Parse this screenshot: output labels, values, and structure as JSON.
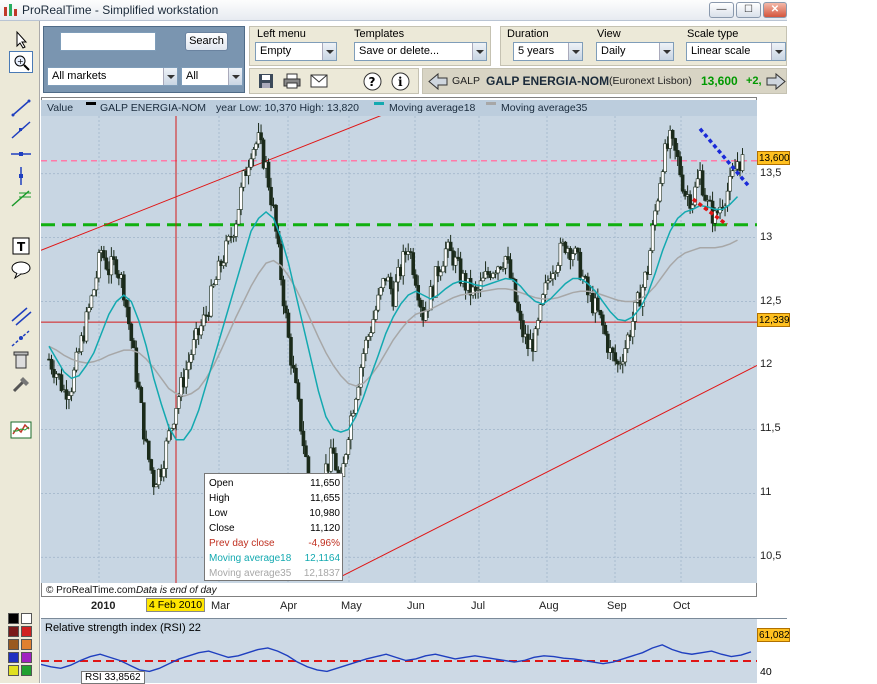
{
  "window": {
    "title": "ProRealTime - Simplified workstation",
    "buttons": [
      "—",
      "☐",
      "✕"
    ]
  },
  "search": {
    "value": "",
    "button": "Search",
    "market": "All markets",
    "filter": "All"
  },
  "settings": {
    "left_menu_label": "Left menu",
    "left_menu_value": "Empty",
    "templates_label": "Templates",
    "templates_value": "Save or delete...",
    "duration_label": "Duration",
    "duration_value": "5 years",
    "view_label": "View",
    "view_value": "Daily",
    "scale_label": "Scale type",
    "scale_value": "Linear scale"
  },
  "instrument": {
    "code": "GALP",
    "name": "GALP ENERGIA-NOM",
    "exchange": "(Euronext Lisbon)",
    "price": "13,600",
    "change": "+2,",
    "up_color": "#009900"
  },
  "legend": {
    "value": "Value",
    "series": "GALP ENERGIA-NOM",
    "year_range": "year Low: 10,370 High: 13,820",
    "ma18": "Moving average18",
    "ma35": "Moving average35",
    "ma18_color": "#13a9b0",
    "ma35_color": "#a7a7a7"
  },
  "chart_data": {
    "type": "candlestick",
    "price_ticks": [
      "13,5",
      "13",
      "12,5",
      "12",
      "11,5",
      "11",
      "10,5"
    ],
    "month_labels": [
      "2010",
      "Mar",
      "Apr",
      "May",
      "Jun",
      "Jul",
      "Aug",
      "Sep",
      "Oct"
    ],
    "cursor_date": "4 Feb 2010",
    "price_markers": {
      "last": "13,600",
      "line": "12,339"
    },
    "support_level": 13.1,
    "resistance_level": 13.6,
    "red_horizontal": 12.339,
    "ylim": [
      10.3,
      13.95
    ],
    "close_series": [
      12.05,
      11.95,
      11.8,
      11.85,
      12.1,
      12.35,
      12.6,
      12.9,
      12.75,
      12.8,
      12.6,
      12.2,
      11.8,
      11.35,
      11.1,
      11.2,
      11.45,
      11.7,
      11.9,
      12.1,
      12.25,
      12.4,
      12.6,
      12.8,
      12.95,
      13.15,
      13.45,
      13.7,
      13.75,
      13.55,
      13.2,
      12.7,
      12.2,
      11.8,
      11.4,
      11.0,
      10.8,
      11.2,
      11.3,
      11.05,
      11.5,
      11.8,
      12.1,
      12.3,
      12.5,
      12.7,
      12.55,
      12.75,
      12.95,
      12.7,
      12.4,
      12.55,
      12.75,
      12.9,
      12.85,
      12.7,
      12.6,
      12.55,
      12.65,
      12.75,
      12.8,
      12.85,
      12.6,
      12.3,
      12.15,
      12.2,
      12.5,
      12.75,
      12.85,
      12.95,
      12.9,
      12.75,
      12.55,
      12.45,
      12.3,
      12.1,
      12.0,
      12.15,
      12.35,
      12.55,
      12.75,
      13.2,
      13.6,
      13.75,
      13.6,
      13.35,
      13.3,
      13.5,
      13.25,
      13.15,
      13.3,
      13.4,
      13.6
    ],
    "ma18": [
      12.15,
      12.05,
      11.95,
      11.9,
      11.92,
      12.0,
      12.1,
      12.25,
      12.4,
      12.5,
      12.55,
      12.5,
      12.35,
      12.15,
      11.9,
      11.7,
      11.52,
      11.42,
      11.42,
      11.5,
      11.65,
      11.85,
      12.05,
      12.25,
      12.45,
      12.65,
      12.85,
      13.05,
      13.15,
      13.2,
      13.15,
      13.0,
      12.8,
      12.55,
      12.3,
      12.05,
      11.8,
      11.6,
      11.5,
      11.48,
      11.5,
      11.6,
      11.75,
      11.92,
      12.08,
      12.25,
      12.38,
      12.48,
      12.55,
      12.58,
      12.55,
      12.52,
      12.55,
      12.6,
      12.64,
      12.66,
      12.65,
      12.63,
      12.62,
      12.64,
      12.66,
      12.68,
      12.67,
      12.62,
      12.55,
      12.5,
      12.48,
      12.52,
      12.58,
      12.64,
      12.68,
      12.68,
      12.64,
      12.58,
      12.5,
      12.42,
      12.36,
      12.35,
      12.38,
      12.45,
      12.56,
      12.72,
      12.9,
      13.05,
      13.15,
      13.2,
      13.22,
      13.25,
      13.24,
      13.22,
      13.22,
      13.26,
      13.32
    ],
    "ma35": [
      12.15,
      12.12,
      12.08,
      12.05,
      12.03,
      12.02,
      12.03,
      12.05,
      12.08,
      12.1,
      12.12,
      12.12,
      12.1,
      12.05,
      11.98,
      11.9,
      11.82,
      11.78,
      11.76,
      11.78,
      11.82,
      11.9,
      12.0,
      12.12,
      12.25,
      12.38,
      12.5,
      12.62,
      12.72,
      12.8,
      12.82,
      12.78,
      12.7,
      12.6,
      12.48,
      12.35,
      12.22,
      12.1,
      12.0,
      11.92,
      11.86,
      11.84,
      11.86,
      11.92,
      12.0,
      12.1,
      12.2,
      12.28,
      12.35,
      12.4,
      12.42,
      12.44,
      12.47,
      12.5,
      12.53,
      12.55,
      12.56,
      12.57,
      12.58,
      12.59,
      12.6,
      12.6,
      12.59,
      12.57,
      12.55,
      12.53,
      12.52,
      12.52,
      12.53,
      12.55,
      12.57,
      12.58,
      12.58,
      12.57,
      12.55,
      12.53,
      12.51,
      12.5,
      12.5,
      12.52,
      12.56,
      12.62,
      12.7,
      12.78,
      12.84,
      12.88,
      12.9,
      12.92,
      12.92,
      12.92,
      12.93,
      12.95,
      12.98
    ]
  },
  "infobox": {
    "open_label": "Open",
    "open": "11,650",
    "high_label": "High",
    "high": "11,655",
    "low_label": "Low",
    "low": "10,980",
    "close_label": "Close",
    "close": "11,120",
    "prev_label": "Prev day close",
    "prev": "-4,96%",
    "ma18_label": "Moving average18",
    "ma18": "12,1164",
    "ma35_label": "Moving average35",
    "ma35": "12,1837"
  },
  "footer": {
    "brand": "© ProRealTime.com",
    "note": "Data is end of day"
  },
  "rsi": {
    "title": "Relative strength index (RSI) 22",
    "value": "61,082",
    "level": "40",
    "readout": "RSI 33,8562",
    "series": [
      45,
      42,
      40,
      44,
      50,
      55,
      58,
      54,
      50,
      44,
      38,
      36,
      40,
      46,
      52,
      56,
      60,
      62,
      58,
      54,
      56,
      60,
      64,
      66,
      62,
      56,
      48,
      42,
      38,
      36,
      40,
      44,
      48,
      52,
      55,
      58,
      54,
      50,
      52,
      56,
      58,
      55,
      52,
      54,
      56,
      54,
      52,
      50,
      48,
      50,
      54,
      56,
      55,
      53,
      52,
      50,
      48,
      46,
      48,
      52,
      56,
      60,
      66,
      70,
      64,
      60,
      58,
      60,
      62,
      58,
      55,
      57,
      61
    ]
  }
}
